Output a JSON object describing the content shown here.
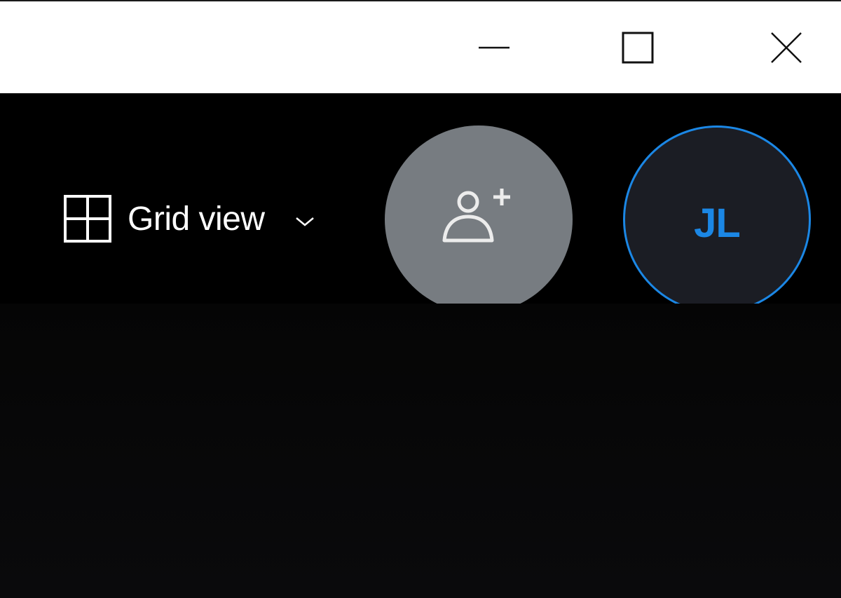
{
  "titlebar": {
    "minimize_icon": "minimize-icon",
    "maximize_icon": "maximize-icon",
    "close_icon": "close-icon"
  },
  "toolbar": {
    "view_selector": {
      "label": "Grid view",
      "icon": "grid-icon",
      "dropdown_icon": "chevron-down-icon"
    },
    "add_person_icon": "add-person-icon",
    "avatar": {
      "initials": "JL",
      "accent": "#1b87e5"
    }
  },
  "colors": {
    "titlebar_bg": "#ffffff",
    "app_bg": "#000000",
    "add_button_bg": "#777c81",
    "avatar_bg": "#1b1d24",
    "avatar_ring": "#1b87e5"
  }
}
